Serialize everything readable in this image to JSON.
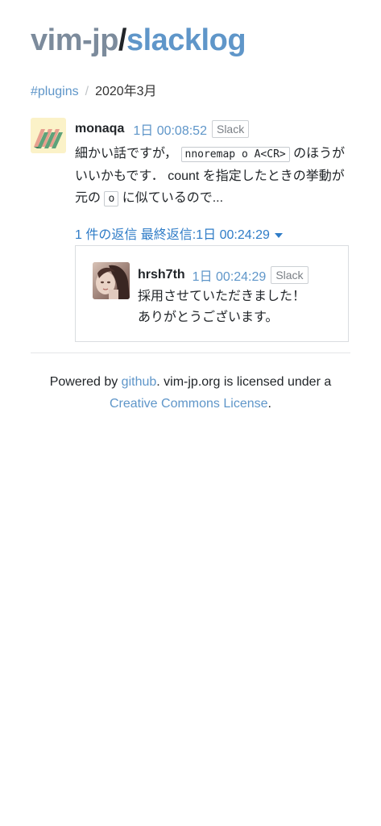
{
  "header": {
    "org": "vim-jp",
    "separator": "/",
    "repo": "slacklog"
  },
  "breadcrumb": {
    "channel": "#plugins",
    "separator": "/",
    "current": "2020年3月"
  },
  "message": {
    "author": "monaqa",
    "timestamp": "1日 00:08:52",
    "source_badge": "Slack",
    "text_1": "細かい話ですが，",
    "code_1": "nnoremap o A<CR>",
    "text_2": " のほうがいいかもです．",
    "text_3": "count を指定したときの挙動が元の ",
    "code_2": "o",
    "text_4": " に似ているので..."
  },
  "replies_toggle": {
    "label": "1 件の返信 最終返信:1日 00:24:29"
  },
  "reply": {
    "author": "hrsh7th",
    "timestamp": "1日 00:24:29",
    "source_badge": "Slack",
    "line_1": "採用させていただきました！",
    "line_2": "ありがとうございます。"
  },
  "footer": {
    "powered_by": "Powered by ",
    "github_link": "github",
    "middle": ". vim-jp.org is licensed under a",
    "license_link": "Creative Commons License",
    "end": "."
  },
  "colors": {
    "link": "#5f96c9",
    "org_title": "#7c8b9c",
    "toggle": "#2f7cc7"
  }
}
